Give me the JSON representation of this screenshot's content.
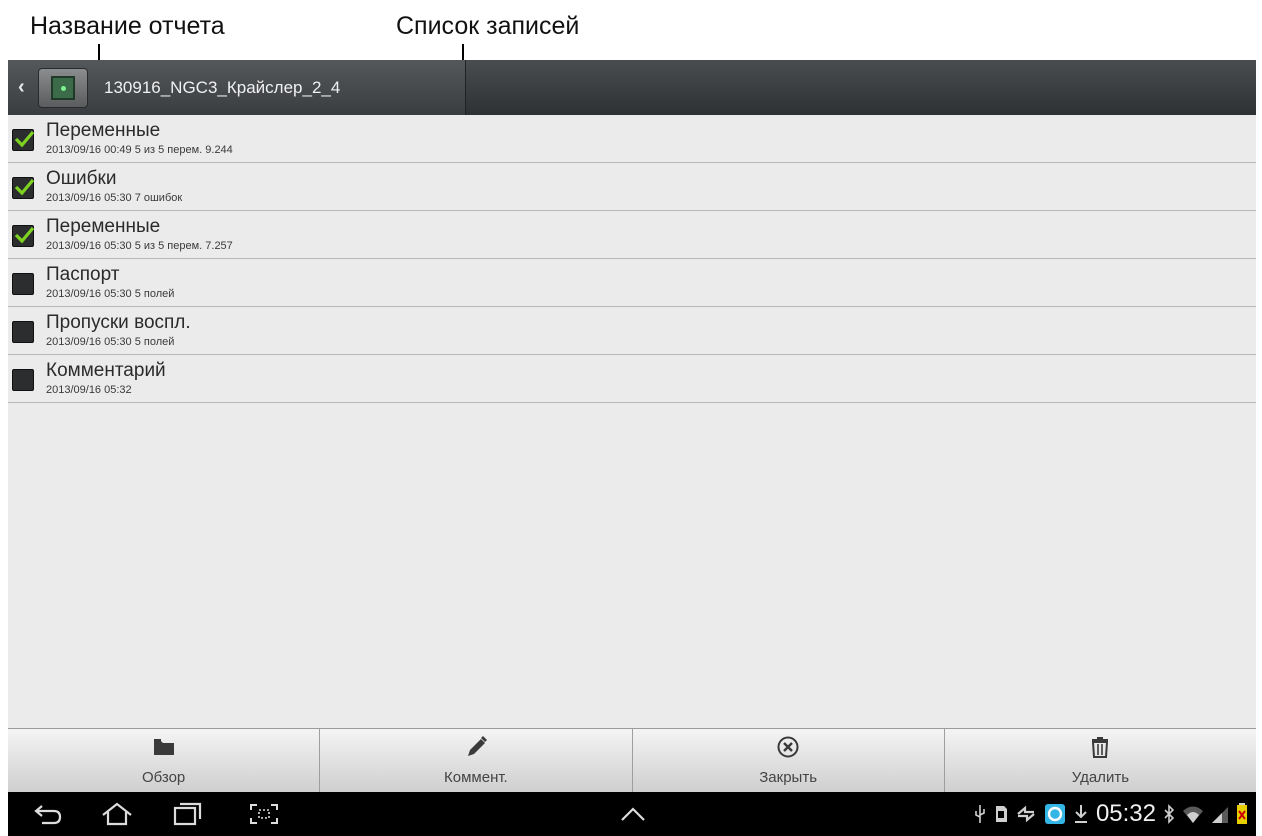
{
  "annotations": {
    "report_name": "Название отчета",
    "record_list": "Список записей"
  },
  "header": {
    "report_title": "130916_NGC3_Крайслер_2_4"
  },
  "records": [
    {
      "title": "Переменные",
      "subtitle": "2013/09/16 00:49  5 из 5 перем. 9.244",
      "checked": true
    },
    {
      "title": "Ошибки",
      "subtitle": "2013/09/16 05:30  7 ошибок",
      "checked": true
    },
    {
      "title": "Переменные",
      "subtitle": "2013/09/16 05:30  5 из 5 перем. 7.257",
      "checked": true
    },
    {
      "title": "Паспорт",
      "subtitle": "2013/09/16 05:30  5 полей",
      "checked": false
    },
    {
      "title": "Пропуски воспл.",
      "subtitle": "2013/09/16 05:30  5 полей",
      "checked": false
    },
    {
      "title": "Комментарий",
      "subtitle": "2013/09/16 05:32",
      "checked": false
    }
  ],
  "toolbar": {
    "browse_label": "Обзор",
    "comment_label": "Коммент.",
    "close_label": "Закрыть",
    "delete_label": "Удалить"
  },
  "status_bar": {
    "time": "05:32"
  },
  "colors": {
    "check_green": "#7ed321",
    "header_dark": "#3a3d40",
    "status_blue": "#33b5e5"
  }
}
